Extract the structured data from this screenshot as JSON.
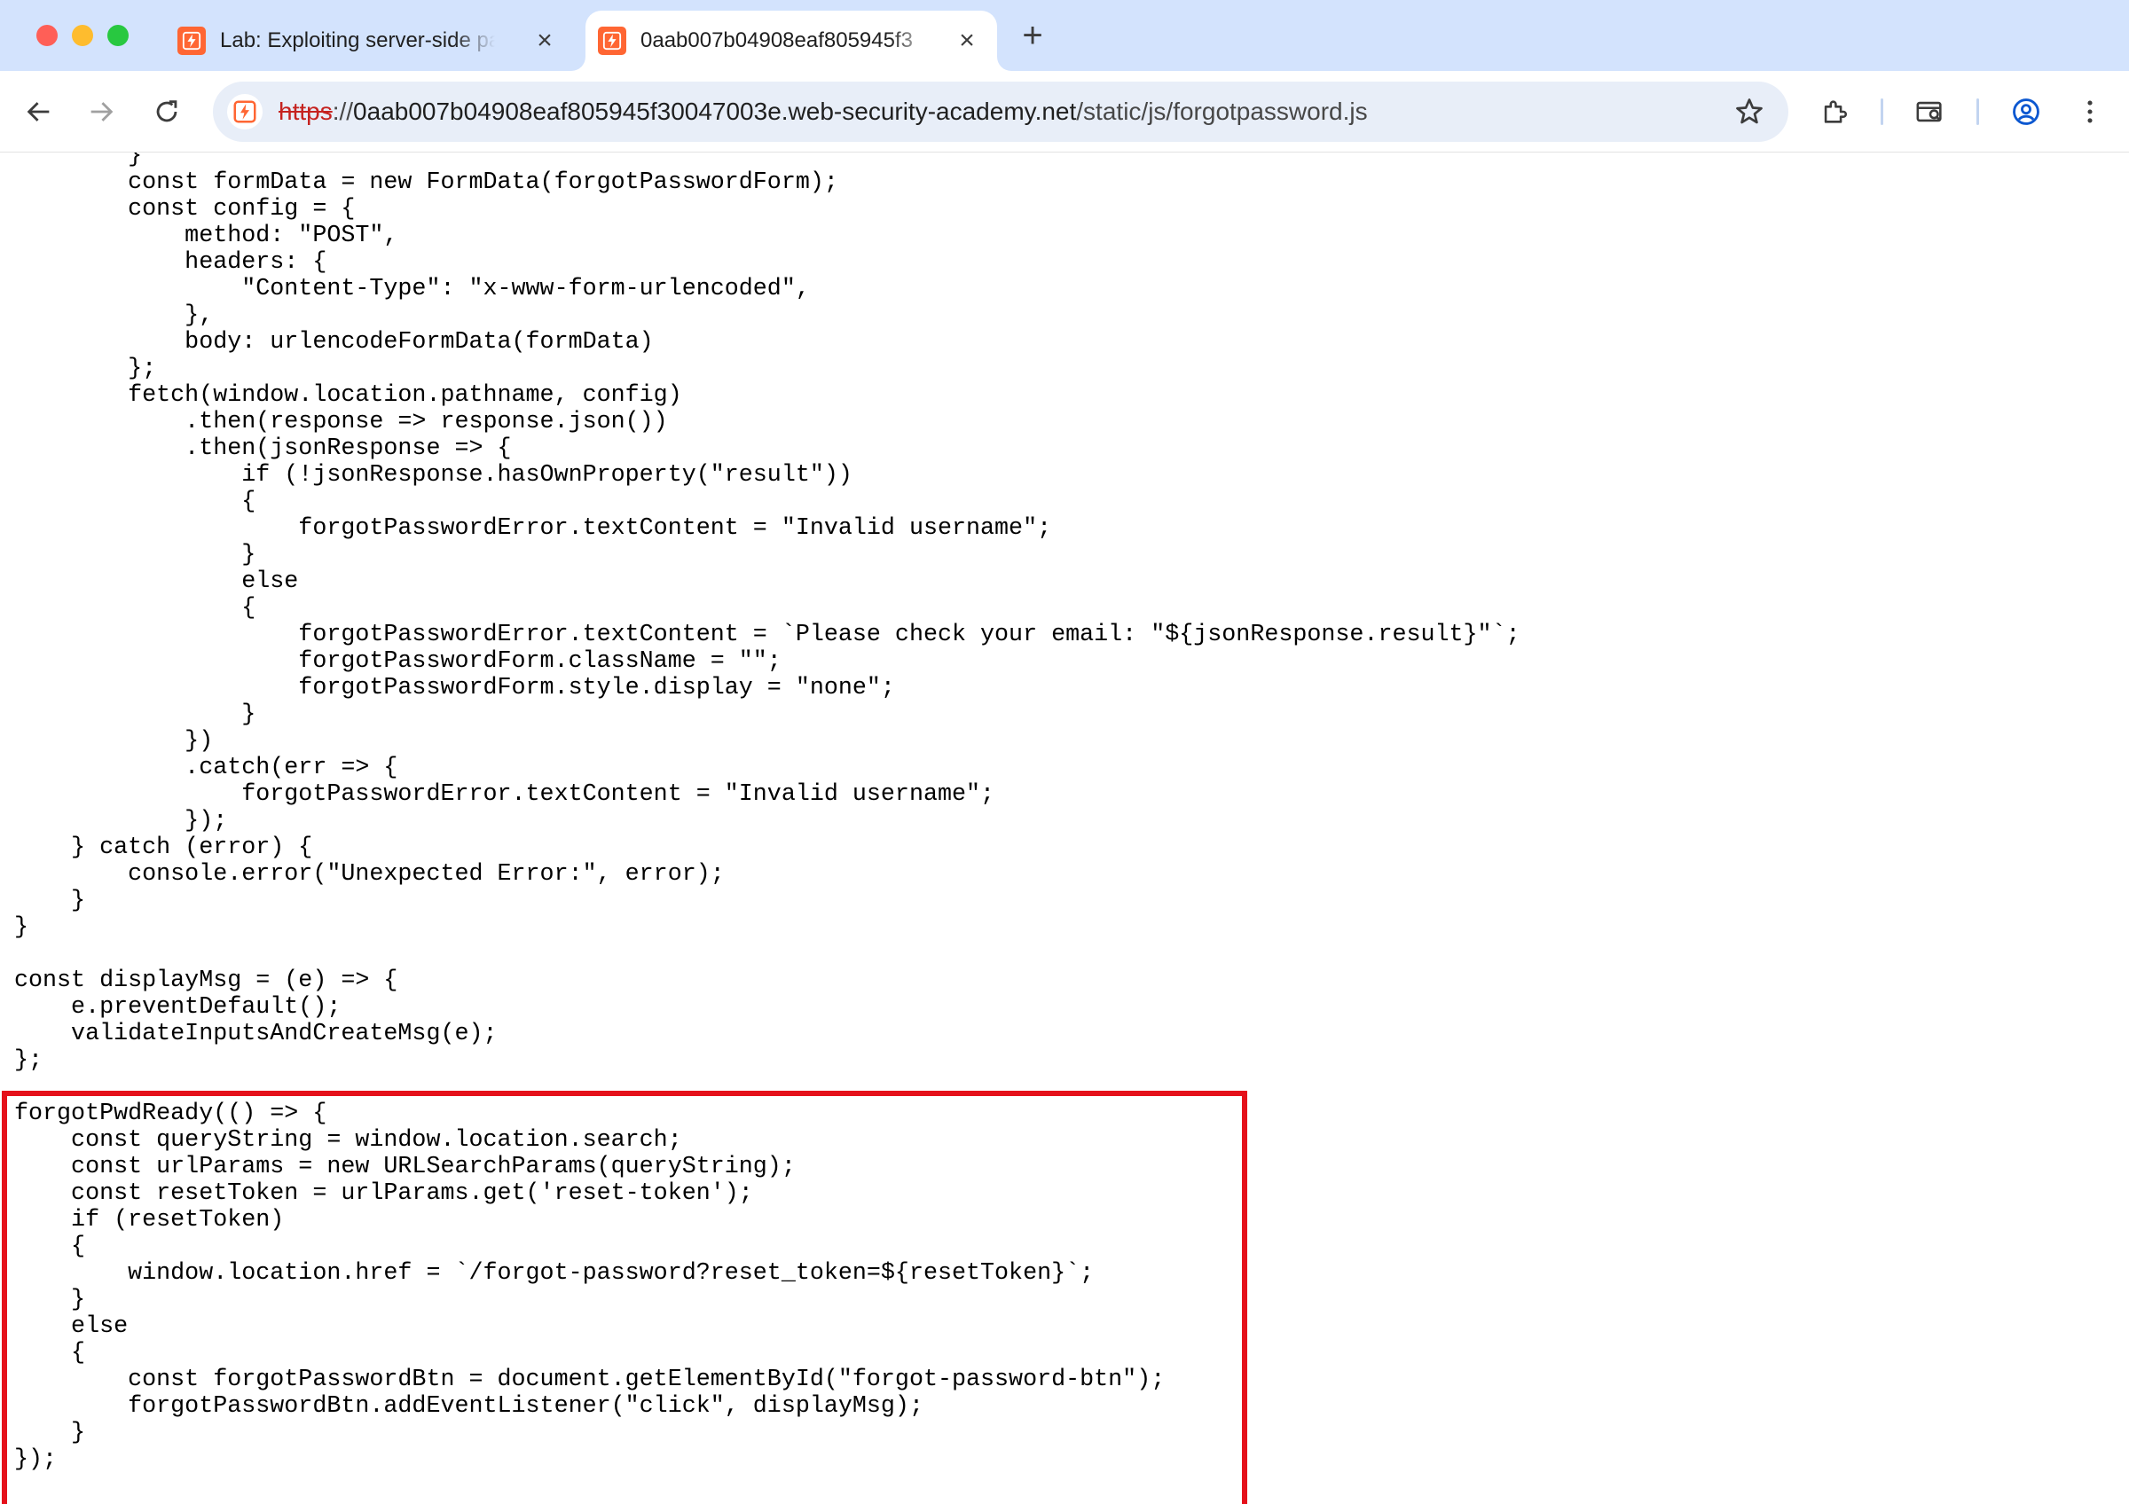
{
  "browser": {
    "tabs": [
      {
        "title": "Lab: Exploiting server-side pa",
        "active": false,
        "favicon": "lightning-icon"
      },
      {
        "title": "0aab007b04908eaf805945f3",
        "active": true,
        "favicon": "lightning-icon"
      }
    ],
    "close_glyph": "×",
    "new_tab_glyph": "+",
    "url": {
      "scheme": "https",
      "separator": "://",
      "host": "0aab007b04908eaf805945f30047003e.web-security-academy.net",
      "path": "/static/js/forgotpassword.js"
    }
  },
  "code": {
    "lines": [
      "        }",
      "        const formData = new FormData(forgotPasswordForm);",
      "        const config = {",
      "            method: \"POST\",",
      "            headers: {",
      "                \"Content-Type\": \"x-www-form-urlencoded\",",
      "            },",
      "            body: urlencodeFormData(formData)",
      "        };",
      "        fetch(window.location.pathname, config)",
      "            .then(response => response.json())",
      "            .then(jsonResponse => {",
      "                if (!jsonResponse.hasOwnProperty(\"result\"))",
      "                {",
      "                    forgotPasswordError.textContent = \"Invalid username\";",
      "                }",
      "                else",
      "                {",
      "                    forgotPasswordError.textContent = `Please check your email: \"${jsonResponse.result}\"`;",
      "                    forgotPasswordForm.className = \"\";",
      "                    forgotPasswordForm.style.display = \"none\";",
      "                }",
      "            })",
      "            .catch(err => {",
      "                forgotPasswordError.textContent = \"Invalid username\";",
      "            });",
      "    } catch (error) {",
      "        console.error(\"Unexpected Error:\", error);",
      "    }",
      "}",
      "",
      "const displayMsg = (e) => {",
      "    e.preventDefault();",
      "    validateInputsAndCreateMsg(e);",
      "};",
      "",
      "forgotPwdReady(() => {",
      "    const queryString = window.location.search;",
      "    const urlParams = new URLSearchParams(queryString);",
      "    const resetToken = urlParams.get('reset-token');",
      "    if (resetToken)",
      "    {",
      "        window.location.href = `/forgot-password?reset_token=${resetToken}`;",
      "    }",
      "    else",
      "    {",
      "        const forgotPasswordBtn = document.getElementById(\"forgot-password-btn\");",
      "        forgotPasswordBtn.addEventListener(\"click\", displayMsg);",
      "    }",
      "});"
    ],
    "highlight_color": "#e5111b"
  }
}
